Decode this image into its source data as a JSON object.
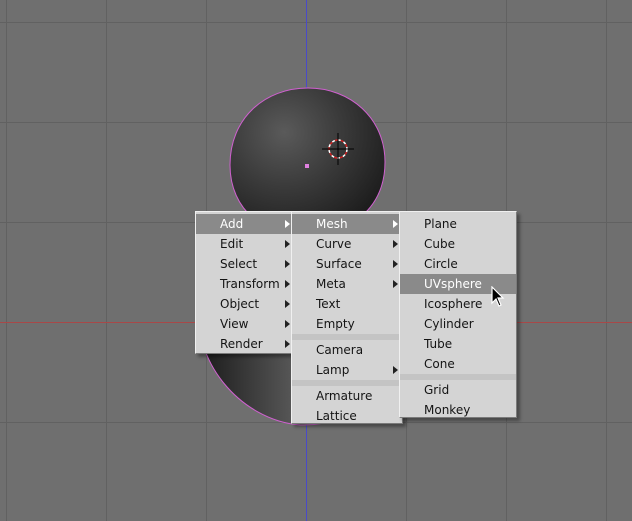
{
  "scene": {
    "background": "#6f6f6f",
    "grid_color": "#5f5f5f",
    "axis_x_color": "#b04040",
    "axis_y_color": "#4040c0",
    "selection_outline": "#e070e0"
  },
  "main_menu": {
    "items": [
      {
        "label": "Add",
        "submenu": true,
        "active": true
      },
      {
        "label": "Edit",
        "submenu": true
      },
      {
        "label": "Select",
        "submenu": true
      },
      {
        "label": "Transform",
        "submenu": true
      },
      {
        "label": "Object",
        "submenu": true
      },
      {
        "label": "View",
        "submenu": true
      },
      {
        "label": "Render",
        "submenu": true
      }
    ]
  },
  "add_menu": {
    "items": [
      {
        "label": "Mesh",
        "submenu": true,
        "active": true
      },
      {
        "label": "Curve",
        "submenu": true
      },
      {
        "label": "Surface",
        "submenu": true
      },
      {
        "label": "Meta",
        "submenu": true
      },
      {
        "label": "Text"
      },
      {
        "label": "Empty"
      },
      {
        "label": "Camera"
      },
      {
        "label": "Lamp",
        "submenu": true
      },
      {
        "label": "Armature"
      },
      {
        "label": "Lattice"
      }
    ]
  },
  "mesh_menu": {
    "items": [
      {
        "label": "Plane"
      },
      {
        "label": "Cube"
      },
      {
        "label": "Circle"
      },
      {
        "label": "UVsphere",
        "active": true
      },
      {
        "label": "Icosphere"
      },
      {
        "label": "Cylinder"
      },
      {
        "label": "Tube"
      },
      {
        "label": "Cone"
      },
      {
        "label": "Grid"
      },
      {
        "label": "Monkey"
      }
    ]
  }
}
